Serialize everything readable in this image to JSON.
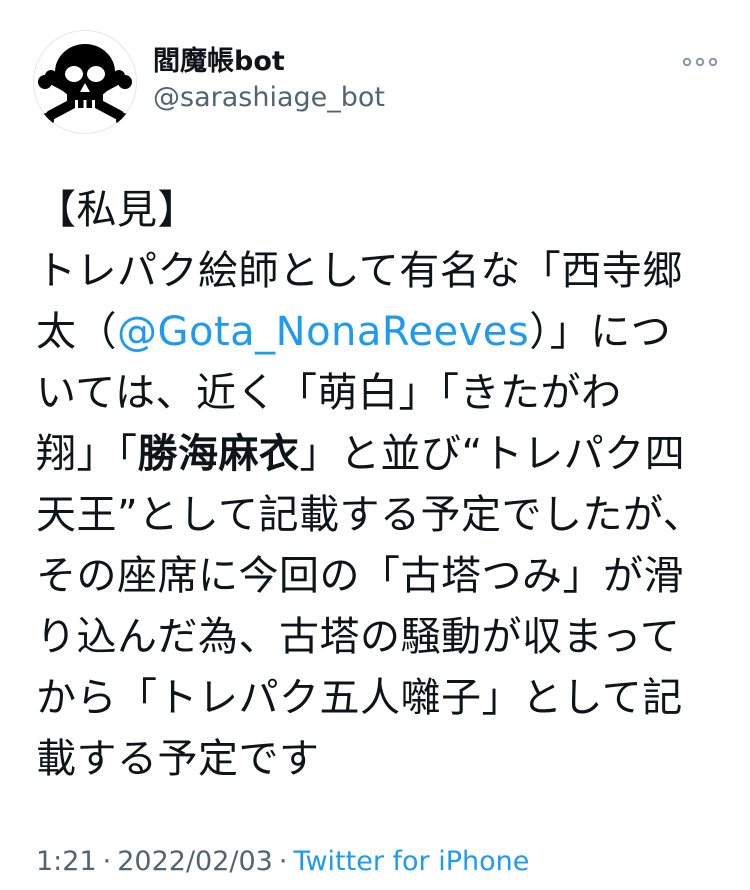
{
  "author": {
    "display_name": "閻魔帳bot",
    "username": "@sarashiage_bot",
    "avatar_icon": "skull-crossbones-icon"
  },
  "menu": {
    "icon": "more-horizontal-icon"
  },
  "tweet": {
    "lines": [
      {
        "segments": [
          {
            "text": "【私見】"
          }
        ]
      },
      {
        "segments": [
          {
            "text": "トレパク絵師として有名な「西寺郷"
          }
        ]
      },
      {
        "segments": [
          {
            "text": "太（"
          },
          {
            "text": "@Gota_NonaReeves",
            "type": "mention"
          },
          {
            "text": "）」につ"
          }
        ]
      },
      {
        "segments": [
          {
            "text": "いては、近く「萌白」「きたがわ"
          }
        ]
      },
      {
        "segments": [
          {
            "text": "翔」「"
          },
          {
            "text": "勝海麻衣",
            "type": "bold"
          },
          {
            "text": "」と並び“トレパク四"
          }
        ]
      },
      {
        "segments": [
          {
            "text": "天王”として記載する予定でしたが、"
          }
        ]
      },
      {
        "segments": [
          {
            "text": "その座席に今回の「古塔つみ」が滑"
          }
        ]
      },
      {
        "segments": [
          {
            "text": "り込んだ為、古塔の騒動が収まって"
          }
        ]
      },
      {
        "segments": [
          {
            "text": "から「トレパク五人囃子」として記"
          }
        ]
      },
      {
        "segments": [
          {
            "text": "載する予定です"
          }
        ]
      }
    ]
  },
  "meta": {
    "time": "1:21",
    "separator": "·",
    "date": "2022/02/03",
    "source": "Twitter for iPhone"
  },
  "colors": {
    "text": "#0f1419",
    "secondary": "#536471",
    "link": "#1d9bf0",
    "background": "#ffffff"
  }
}
